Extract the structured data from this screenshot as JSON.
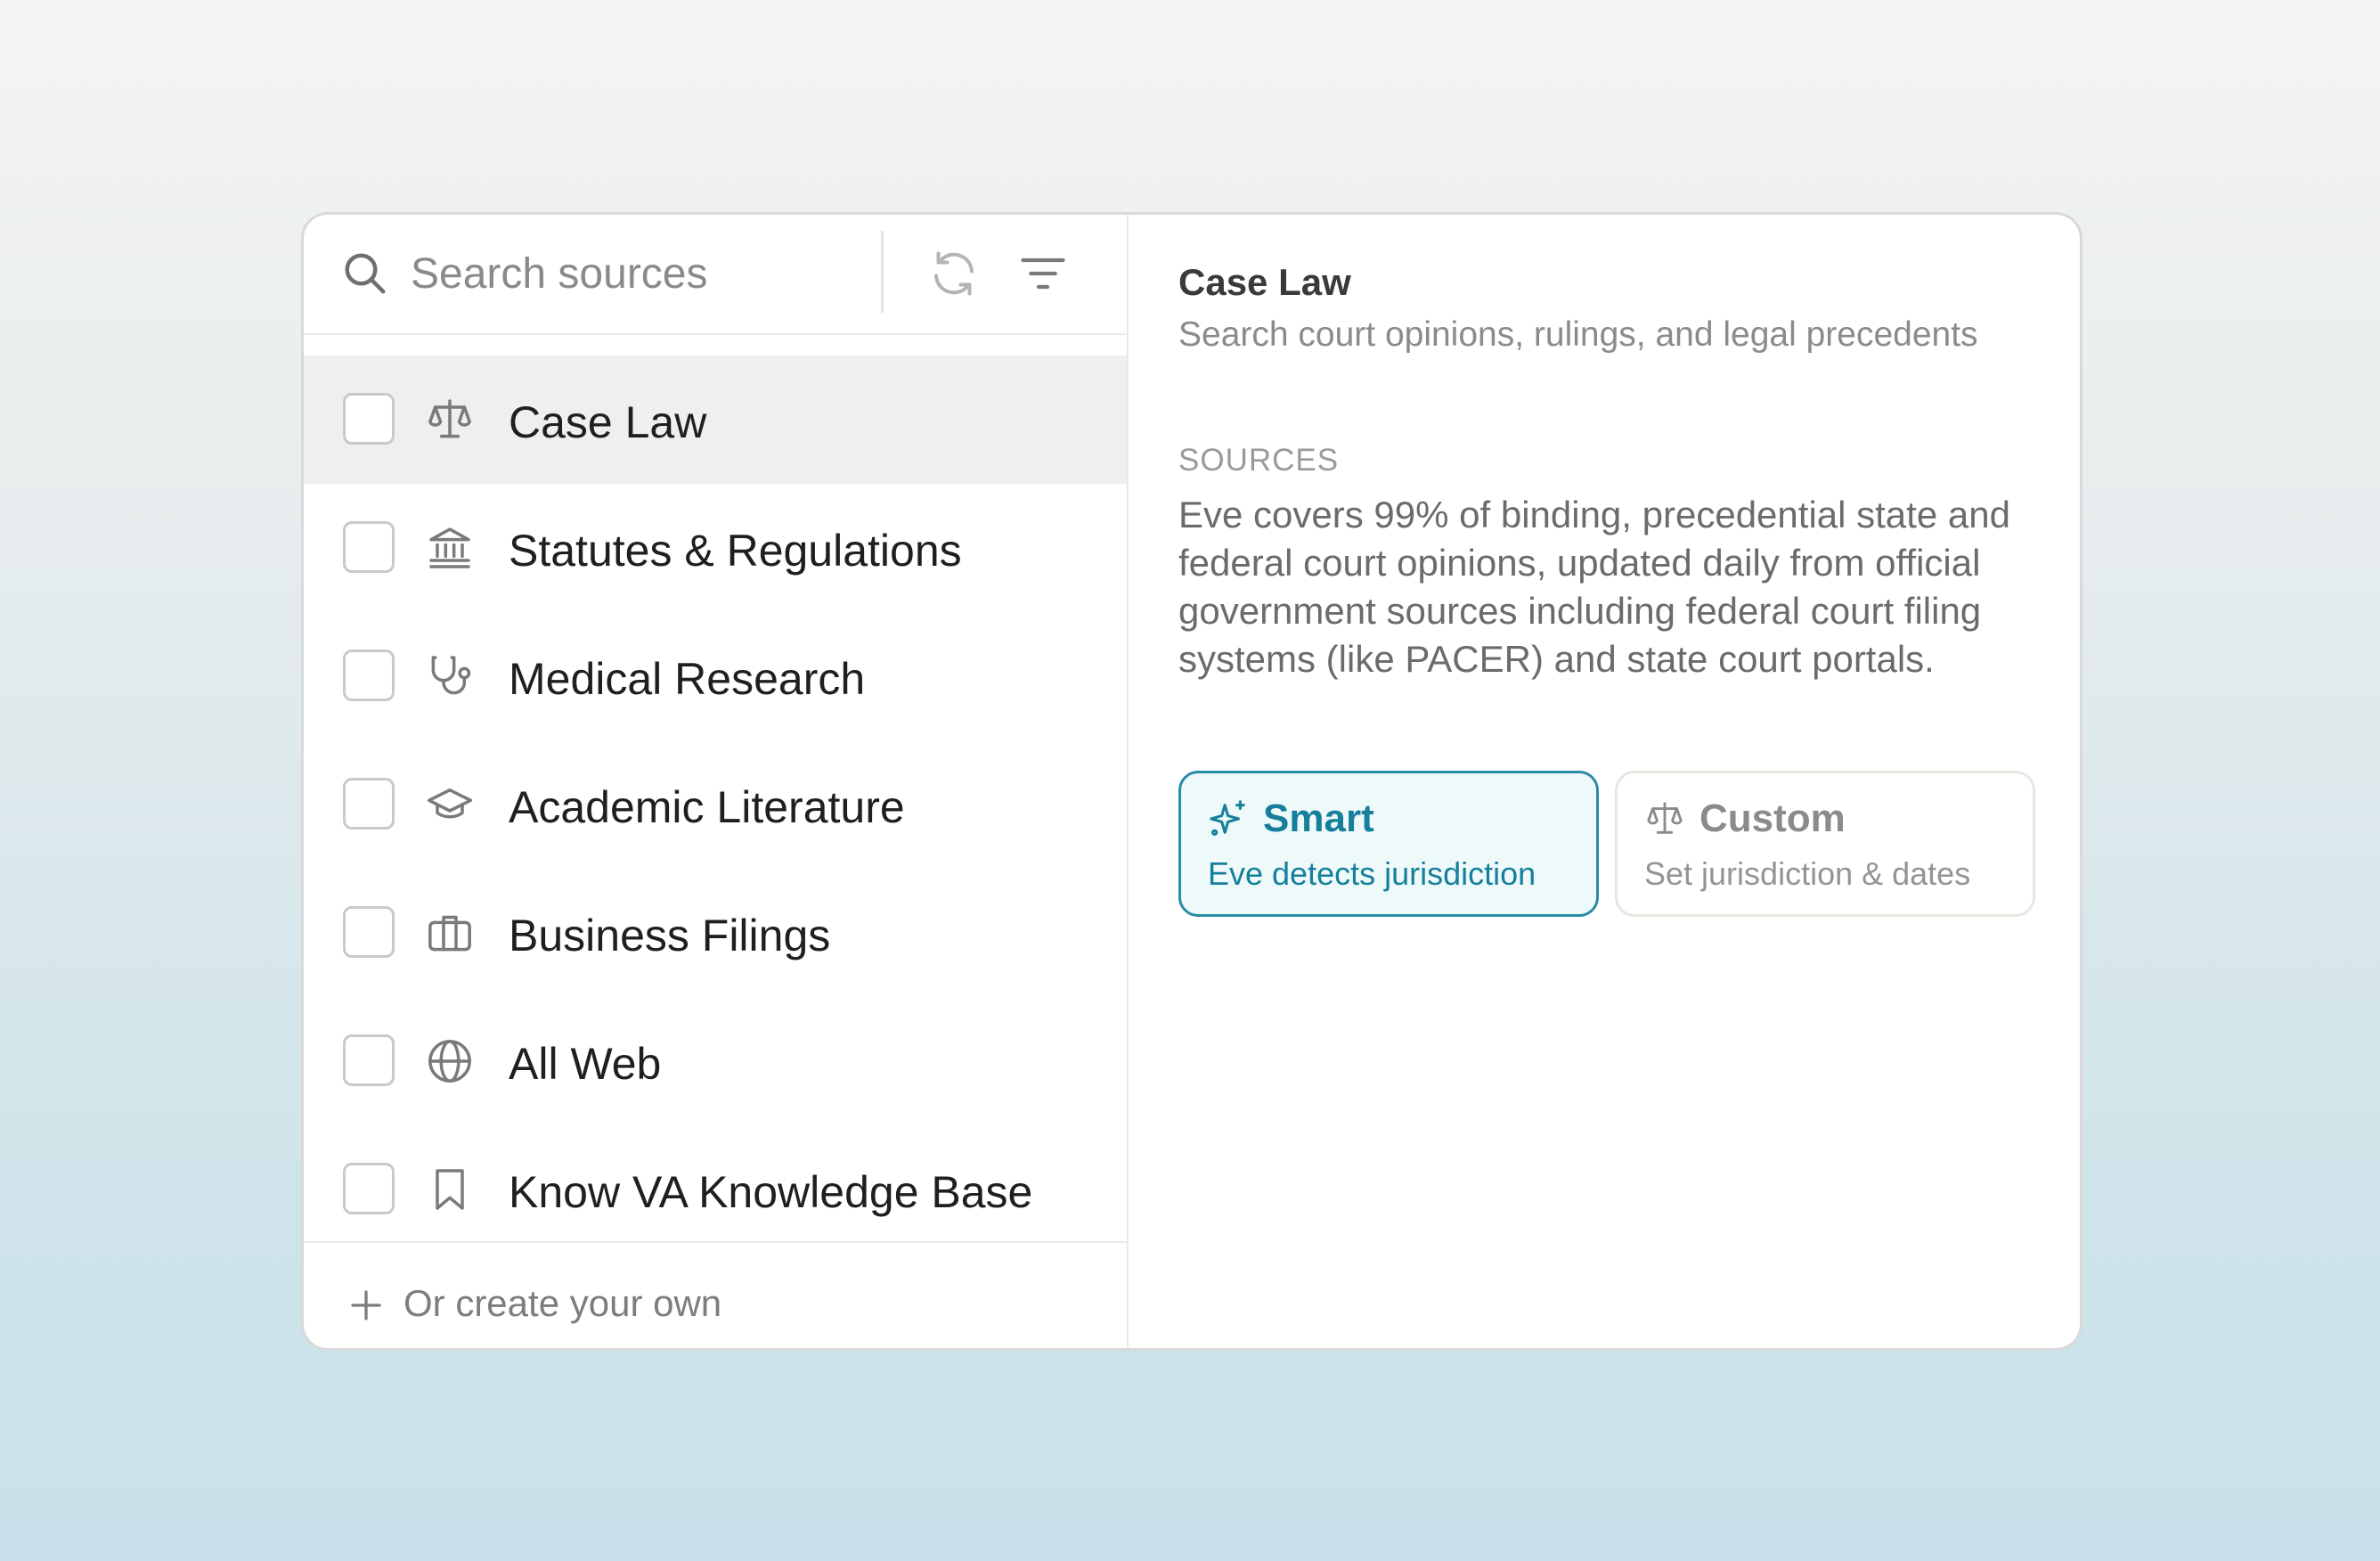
{
  "search": {
    "placeholder": "Search sources",
    "value": ""
  },
  "sources_list": [
    {
      "label": "Case Law",
      "icon": "scale-icon",
      "checked": false,
      "active": true
    },
    {
      "label": "Statutes & Regulations",
      "icon": "government-building-icon",
      "checked": false,
      "active": false
    },
    {
      "label": "Medical Research",
      "icon": "stethoscope-icon",
      "checked": false,
      "active": false
    },
    {
      "label": "Academic Literature",
      "icon": "graduation-cap-icon",
      "checked": false,
      "active": false
    },
    {
      "label": "Business Filings",
      "icon": "briefcase-icon",
      "checked": false,
      "active": false
    },
    {
      "label": "All Web",
      "icon": "globe-icon",
      "checked": false,
      "active": false
    },
    {
      "label": "Know VA Knowledge Base",
      "icon": "bookmark-icon",
      "checked": false,
      "active": false
    }
  ],
  "footer": {
    "create_label": "Or create your own"
  },
  "detail": {
    "title": "Case Law",
    "description": "Search court opinions, rulings, and legal precedents",
    "sources_heading": "SOURCES",
    "sources_text": "Eve covers 99% of binding, precedential state and federal court opinions, updated daily from official government sources including federal court filing systems (like PACER) and state court portals.",
    "modes": {
      "smart": {
        "title": "Smart",
        "subtitle": "Eve detects jurisdiction",
        "selected": true
      },
      "custom": {
        "title": "Custom",
        "subtitle": "Set jurisdiction & dates",
        "selected": false
      }
    }
  },
  "colors": {
    "accent": "#167f9c",
    "accent_border": "#2a8ba5",
    "accent_bg": "#eefafa",
    "active_row": "#efefef"
  }
}
